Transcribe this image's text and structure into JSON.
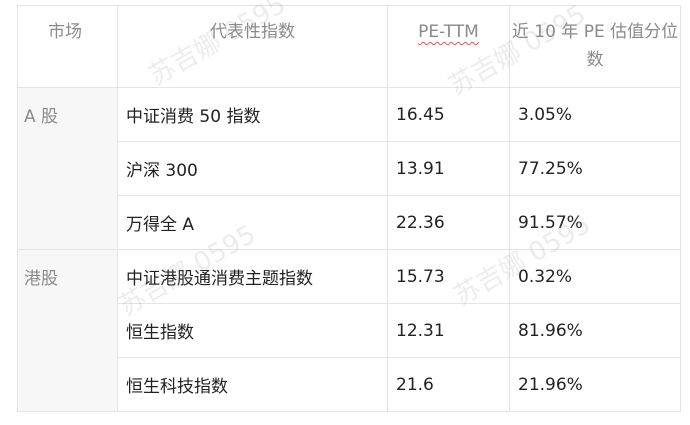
{
  "table": {
    "headers": [
      "市场",
      "代表性指数",
      "PE-TTM",
      "近 10 年 PE 估值分位数"
    ],
    "groups": [
      {
        "market": "A 股",
        "rows": [
          {
            "index": "中证消费 50 指数",
            "pe": "16.45",
            "pct": "3.05%"
          },
          {
            "index": "沪深 300",
            "pe": "13.91",
            "pct": "77.25%"
          },
          {
            "index": "万得全 A",
            "pe": "22.36",
            "pct": "91.57%"
          }
        ]
      },
      {
        "market": "港股",
        "rows": [
          {
            "index": "中证港股通消费主题指数",
            "pe": "15.73",
            "pct": "0.32%"
          },
          {
            "index": "恒生指数",
            "pe": "12.31",
            "pct": "81.96%"
          },
          {
            "index": "恒生科技指数",
            "pe": "21.6",
            "pct": "21.96%"
          }
        ]
      }
    ]
  },
  "watermark": {
    "text_top": "苏吉娜 0595",
    "text_mid": "苏吉娜 0595",
    "text_low": "苏吉娜 0595"
  }
}
